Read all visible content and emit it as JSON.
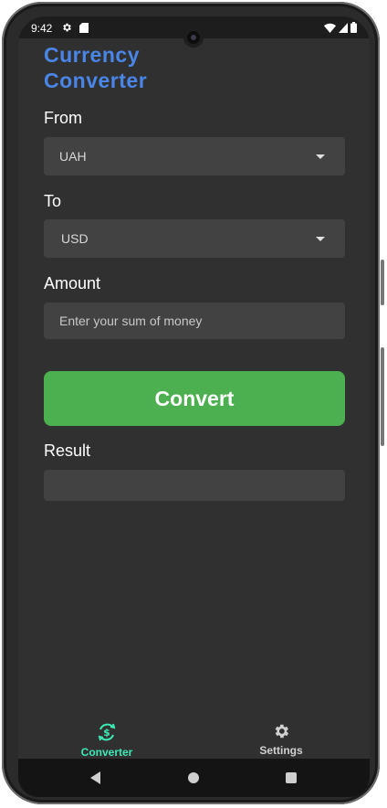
{
  "status_bar": {
    "time": "9:42",
    "settings_icon": "gear-icon",
    "sd_icon": "sd-card-icon",
    "wifi_icon": "wifi-icon",
    "signal_icon": "signal-icon",
    "battery_icon": "battery-icon"
  },
  "app": {
    "title_line1": "Currency",
    "title_line2": "Converter",
    "title_color": "#4a86e8"
  },
  "form": {
    "from_label": "From",
    "from_value": "UAH",
    "to_label": "To",
    "to_value": "USD",
    "amount_label": "Amount",
    "amount_placeholder": "Enter your sum of money",
    "amount_value": "",
    "convert_label": "Convert",
    "convert_color": "#4caf50",
    "result_label": "Result",
    "result_value": ""
  },
  "bottom_nav": {
    "items": [
      {
        "label": "Converter",
        "icon": "currency-exchange-icon",
        "active": true,
        "color": "#3ee8b5"
      },
      {
        "label": "Settings",
        "icon": "gear-icon",
        "active": false,
        "color": "#d0d0d0"
      }
    ]
  },
  "system_nav": {
    "back_icon": "back-icon",
    "home_icon": "home-icon",
    "recents_icon": "recents-icon"
  }
}
